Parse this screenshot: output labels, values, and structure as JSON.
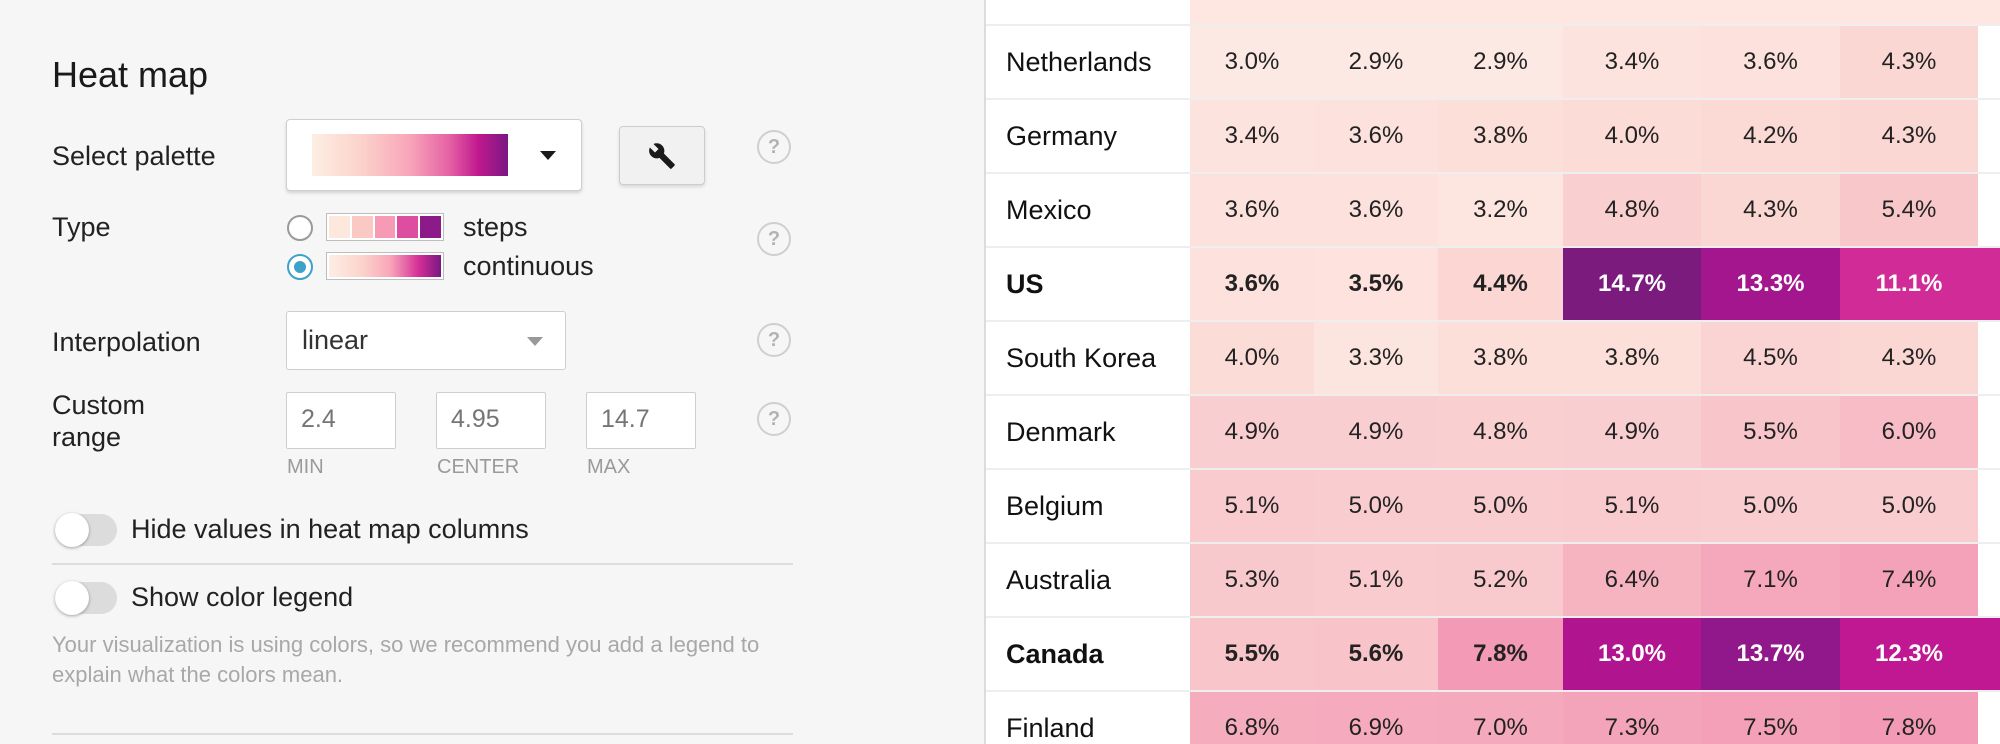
{
  "panel": {
    "title": "Heat map",
    "select_palette_label": "Select palette",
    "type_label": "Type",
    "type_options": [
      {
        "label": "steps",
        "selected": false
      },
      {
        "label": "continuous",
        "selected": true
      }
    ],
    "interpolation_label": "Interpolation",
    "interpolation_value": "linear",
    "custom_range_label_1": "Custom",
    "custom_range_label_2": "range",
    "range_min_placeholder": "2.4",
    "range_center_placeholder": "4.95",
    "range_max_placeholder": "14.7",
    "min_caption": "MIN",
    "center_caption": "CENTER",
    "max_caption": "MAX",
    "help_glyph": "?",
    "hide_values_label": "Hide values in heat map columns",
    "show_legend_label": "Show color legend",
    "legend_note": "Your visualization is using colors, so we recommend you add a legend to explain what the colors mean.",
    "accent_color": "#3ea1c9",
    "icons": [
      "chevron-down-icon",
      "wrench-icon",
      "help-icon"
    ]
  },
  "table": {
    "rows": [
      {
        "country": "Netherlands",
        "bold": false,
        "values": [
          "3.0%",
          "2.9%",
          "2.9%",
          "3.4%",
          "3.6%",
          "4.3%"
        ],
        "colors": [
          "#fde9e3",
          "#fde9e3",
          "#fde9e3",
          "#fde3dd",
          "#fce1dc",
          "#fbd7d4"
        ]
      },
      {
        "country": "Germany",
        "bold": false,
        "values": [
          "3.4%",
          "3.6%",
          "3.8%",
          "4.0%",
          "4.2%",
          "4.3%"
        ],
        "colors": [
          "#fde3dd",
          "#fce1dc",
          "#fcdfd9",
          "#fcdcd7",
          "#fbd9d5",
          "#fbd7d4"
        ]
      },
      {
        "country": "Mexico",
        "bold": false,
        "values": [
          "3.6%",
          "3.6%",
          "3.2%",
          "4.8%",
          "4.3%",
          "5.4%"
        ],
        "colors": [
          "#fce1dc",
          "#fce1dc",
          "#fde6e0",
          "#f9d0cf",
          "#fbd7d4",
          "#f8c7ca"
        ]
      },
      {
        "country": "US",
        "bold": true,
        "values": [
          "3.6%",
          "3.5%",
          "4.4%",
          "14.7%",
          "13.3%",
          "11.1%"
        ],
        "colors": [
          "#fce1dc",
          "#fde2dd",
          "#fbd6d3",
          "#7a1b7d",
          "#a3168d",
          "#d02b96"
        ]
      },
      {
        "country": "South Korea",
        "bold": false,
        "values": [
          "4.0%",
          "3.3%",
          "3.8%",
          "3.8%",
          "4.5%",
          "4.3%"
        ],
        "colors": [
          "#fcdcd7",
          "#fde5df",
          "#fcdfd9",
          "#fcdfd9",
          "#fad4d2",
          "#fbd7d4"
        ]
      },
      {
        "country": "Denmark",
        "bold": false,
        "values": [
          "4.9%",
          "4.9%",
          "4.8%",
          "4.9%",
          "5.5%",
          "6.0%"
        ],
        "colors": [
          "#f9ced0",
          "#f9ced0",
          "#f9d0cf",
          "#f9ced0",
          "#f8c6ca",
          "#f7bcc5"
        ]
      },
      {
        "country": "Belgium",
        "bold": false,
        "values": [
          "5.1%",
          "5.0%",
          "5.0%",
          "5.1%",
          "5.0%",
          "5.0%"
        ],
        "colors": [
          "#f9cbce",
          "#f9cdcf",
          "#f9cdcf",
          "#f9cbce",
          "#f9cdcf",
          "#f9cdcf"
        ]
      },
      {
        "country": "Australia",
        "bold": false,
        "values": [
          "5.3%",
          "5.1%",
          "5.2%",
          "6.4%",
          "7.1%",
          "7.4%"
        ],
        "colors": [
          "#f8c9cc",
          "#f9cbce",
          "#f9cacd",
          "#f6b4c1",
          "#f5a7bb",
          "#f4a2b9"
        ]
      },
      {
        "country": "Canada",
        "bold": true,
        "values": [
          "5.5%",
          "5.6%",
          "7.8%",
          "13.0%",
          "13.7%",
          "12.3%"
        ],
        "colors": [
          "#f8c6ca",
          "#f8c4c9",
          "#f39bb6",
          "#b0148f",
          "#91188a",
          "#c01892"
        ]
      },
      {
        "country": "Finland",
        "bold": false,
        "values": [
          "6.8%",
          "6.9%",
          "7.0%",
          "7.3%",
          "7.5%",
          "7.8%"
        ],
        "colors": [
          "#f5adbe",
          "#f5abbd",
          "#f5a9bc",
          "#f4a4ba",
          "#f4a0b8",
          "#f39bb6"
        ]
      }
    ]
  }
}
